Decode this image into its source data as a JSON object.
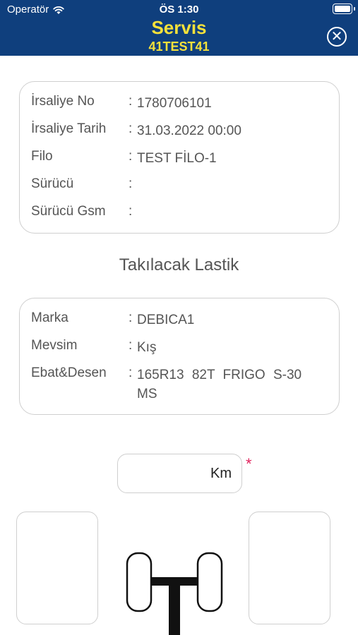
{
  "status_bar": {
    "carrier": "Operatör",
    "time": "ÖS 1:30"
  },
  "header": {
    "title": "Servis",
    "subtitle": "41TEST41"
  },
  "waybill": [
    {
      "label": "İrsaliye No",
      "sep": ":",
      "value": "1780706101"
    },
    {
      "label": "İrsaliye Tarih",
      "sep": ":",
      "value": "31.03.2022 00:00"
    },
    {
      "label": "Filo",
      "sep": ":",
      "value": "TEST FİLO-1"
    },
    {
      "label": "Sürücü",
      "sep": ":",
      "value": ""
    },
    {
      "label": "Sürücü Gsm",
      "sep": ":",
      "value": ""
    }
  ],
  "tire_section_title": "Takılacak Lastik",
  "tire": [
    {
      "label": "Marka",
      "sep": ":",
      "value": "DEBICA1"
    },
    {
      "label": "Mevsim",
      "sep": ":",
      "value": "Kış"
    },
    {
      "label": "Ebat&Desen",
      "sep": ":",
      "value": "165R13  82T  FRIGO  S-30  MS"
    }
  ],
  "km": {
    "unit": "Km",
    "required_mark": "*"
  },
  "icons": {
    "close": "close-circle-icon",
    "wifi": "wifi-icon",
    "battery": "battery-icon"
  },
  "colors": {
    "header_bg": "#0f3f7d",
    "title": "#f5e13a",
    "required": "#e0245e"
  }
}
